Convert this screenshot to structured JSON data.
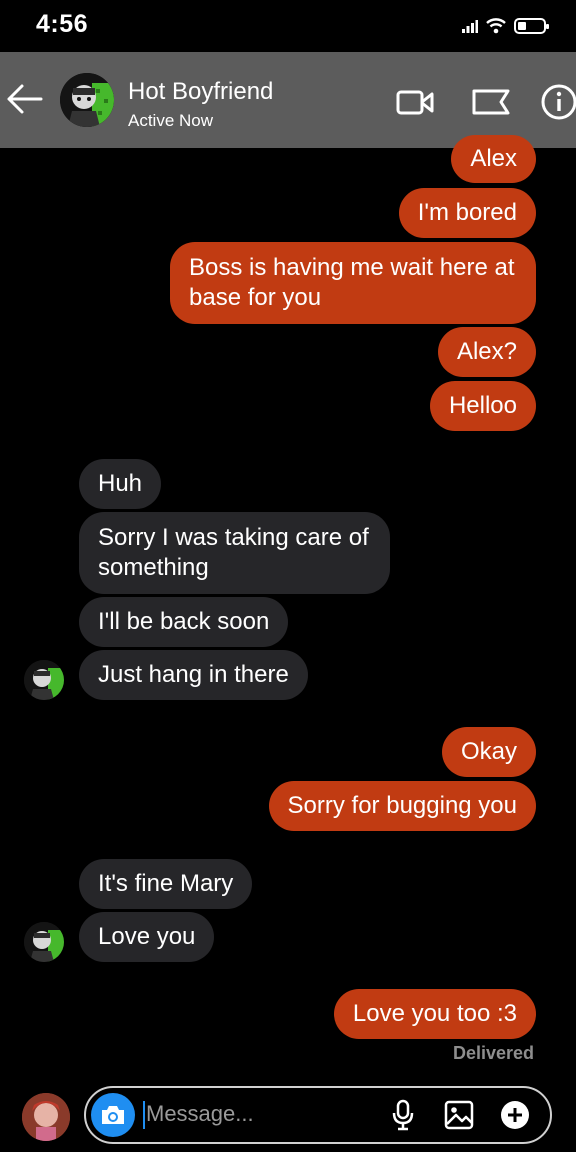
{
  "status_bar": {
    "time": "4:56"
  },
  "header": {
    "name": "Hot Boyfriend",
    "status": "Active Now"
  },
  "messages": [
    {
      "from": "me",
      "text": "Alex"
    },
    {
      "from": "me",
      "text": "I'm bored"
    },
    {
      "from": "me",
      "text": "Boss is having me wait here at base for you"
    },
    {
      "from": "me",
      "text": "Alex?"
    },
    {
      "from": "me",
      "text": "Helloo"
    },
    {
      "from": "them",
      "text": "Huh"
    },
    {
      "from": "them",
      "text": "Sorry I was taking care of something"
    },
    {
      "from": "them",
      "text": "I'll be back soon"
    },
    {
      "from": "them",
      "text": "Just hang in there"
    },
    {
      "from": "me",
      "text": "Okay"
    },
    {
      "from": "me",
      "text": "Sorry for bugging you"
    },
    {
      "from": "them",
      "text": "It's fine Mary"
    },
    {
      "from": "them",
      "text": "Love you"
    },
    {
      "from": "me",
      "text": "Love you too :3"
    }
  ],
  "delivered": "Delivered",
  "composer": {
    "placeholder": "Message..."
  },
  "colors": {
    "sent_bubble": "#c13b12",
    "received_bubble": "#262629",
    "header_bg": "#5c5c5c",
    "accent": "#1f8ef1"
  },
  "icons": [
    "back-arrow-icon",
    "video-call-icon",
    "flag-icon",
    "info-icon",
    "camera-icon",
    "microphone-icon",
    "gallery-icon",
    "add-icon"
  ]
}
